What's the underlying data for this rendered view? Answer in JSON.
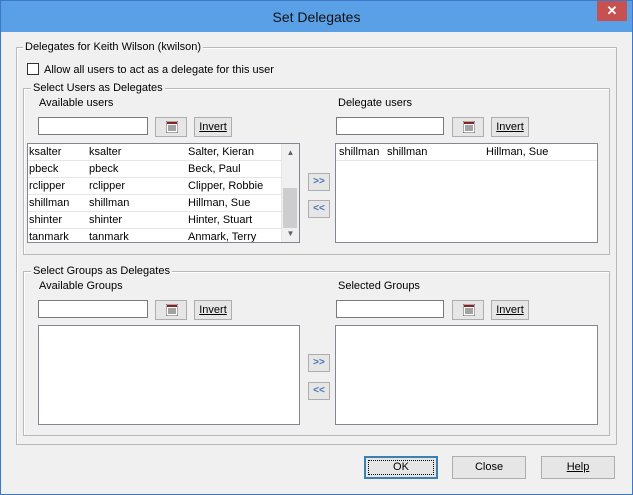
{
  "window": {
    "title": "Set Delegates",
    "close_glyph": "✕"
  },
  "delegates_group": {
    "label": "Delegates for Keith Wilson (kwilson)",
    "allow_all_label": "Allow all users to act as a delegate for this user"
  },
  "users_group": {
    "label": "Select Users as Delegates",
    "available_label": "Available users",
    "delegate_label": "Delegate users",
    "invert_label": "Invert",
    "available_rows": [
      {
        "id": "ksalter",
        "login": "ksalter",
        "name": "Salter, Kieran"
      },
      {
        "id": "pbeck",
        "login": "pbeck",
        "name": "Beck, Paul"
      },
      {
        "id": "rclipper",
        "login": "rclipper",
        "name": "Clipper, Robbie"
      },
      {
        "id": "shillman",
        "login": "shillman",
        "name": "Hillman, Sue"
      },
      {
        "id": "shinter",
        "login": "shinter",
        "name": "Hinter, Stuart"
      },
      {
        "id": "tanmark",
        "login": "tanmark",
        "name": "Anmark, Terry"
      }
    ],
    "delegate_rows": [
      {
        "id": "shillman",
        "login": "shillman",
        "name": "Hillman, Sue"
      }
    ],
    "add_label": ">>",
    "remove_label": "<<"
  },
  "groups_group": {
    "label": "Select Groups as Delegates",
    "available_label": "Available Groups",
    "selected_label": "Selected Groups",
    "invert_label": "Invert",
    "add_label": ">>",
    "remove_label": "<<"
  },
  "footer": {
    "ok_label": "OK",
    "close_label": "Close",
    "help_label": "Help"
  },
  "icons": {
    "filter": "filter-list-icon"
  },
  "colors": {
    "title_bar": "#5aa0e6",
    "close_button": "#c75050",
    "arrow_text": "#4a72b0"
  }
}
